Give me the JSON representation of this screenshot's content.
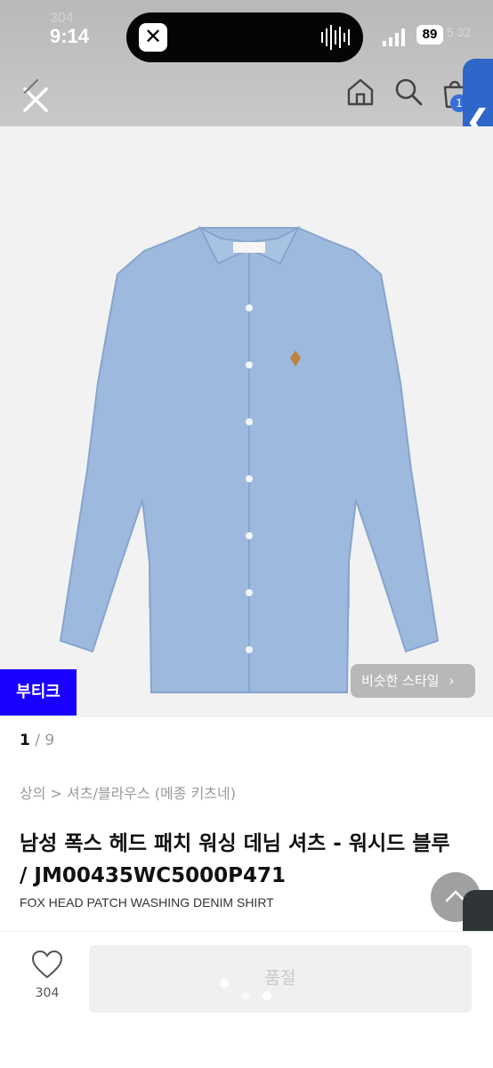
{
  "status_bar": {
    "time": "9:14",
    "ghost_time": "304",
    "battery": "89",
    "ghost_battery": "5 32"
  },
  "header": {
    "close_icon": "close-icon",
    "home_icon": "home-icon",
    "search_icon": "search-icon",
    "cart_icon": "cart-icon",
    "cart_badge": "1"
  },
  "side_tabs": [
    {
      "icon": "chevron-left-icon",
      "label": "❮",
      "color": "#2f66c9"
    },
    {
      "icon": "chevron-left-icon",
      "label": "❮",
      "color": "#2f3436"
    }
  ],
  "product": {
    "brand_badge": "부티크",
    "similar_style_button": "비슷한 스타일",
    "image_counter_current": "1",
    "image_counter_total": " / 9",
    "breadcrumb": "상의 > 셔츠/블라우스 (메종 키츠네)",
    "title": "남성 폭스 헤드 패치 워싱 데님 셔츠 - 워시드 블루 / JM00435WC5000P471",
    "subtitle": "FOX HEAD PATCH WASHING DENIM SHIRT",
    "image_color": "#9db9dd"
  },
  "actions": {
    "like_count": "304",
    "soldout_label": "품절"
  },
  "colors": {
    "brand_badge": "#1900ff",
    "accent_tab": "#2f66c9"
  }
}
